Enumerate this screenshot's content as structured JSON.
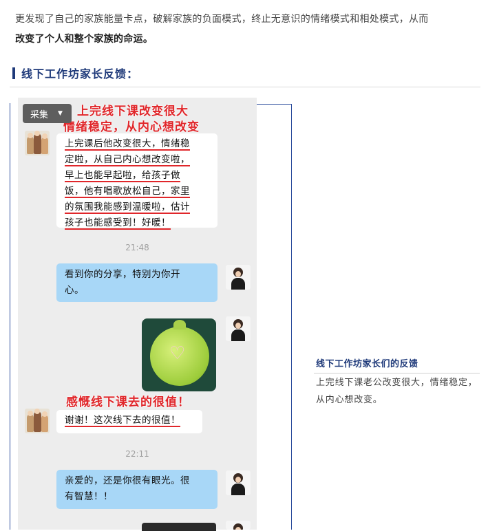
{
  "intro": {
    "text_normal": "更发现了自己的家族能量卡点，破解家族的负面模式，终止无意识的情绪模式和相处模式，从而",
    "text_bold": "改变了个人和整个家族的命运。"
  },
  "section": {
    "title": "线下工作坊家长反馈："
  },
  "chat": {
    "collect_label": "采集",
    "annot_top": [
      "上完线下课改变很大",
      "情绪稳定，从内心想改变"
    ],
    "msg1_lines": [
      "上完课后他改变很大，情绪稳",
      "定啦，从自己内心想改变啦，",
      "早上也能早起啦，给孩子做",
      "饭，他有唱歌放松自己，家里",
      "的氛围我能感到温暖啦，估计",
      "孩子也能感受到！好暖！"
    ],
    "time1": "21:48",
    "msg2_lines": [
      "看到你的分享，特别为你开",
      "心。"
    ],
    "annot_mid": "感慨线下课去的很值！",
    "msg3": "谢谢！这次线下去的很值！",
    "time2": "22:11",
    "msg4_lines": [
      "亲爱的，还是你很有眼光。很",
      "有智慧！！"
    ]
  },
  "caption": {
    "title": "线下工作坊家长们的反馈",
    "body": "上完线下课老公改变很大，情绪稳定，从内心想改变。"
  }
}
